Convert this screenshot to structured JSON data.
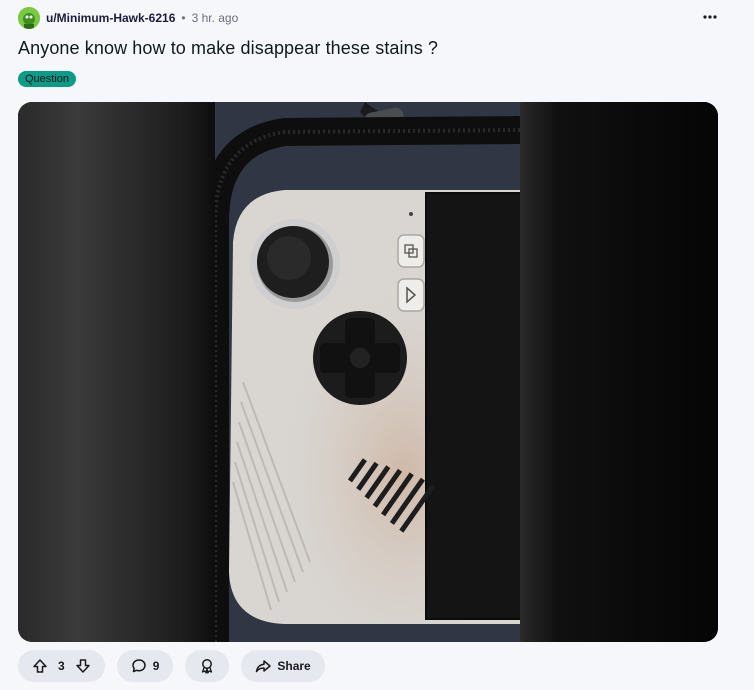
{
  "post": {
    "username": "u/Minimum-Hawk-6216",
    "separator": "•",
    "time": "3 hr. ago",
    "title": "Anyone know how to make disappear these stains ?",
    "flair": "Question",
    "flair_color": "#0a9c87"
  },
  "actions": {
    "vote_count": "3",
    "comment_count": "9",
    "share_label": "Share"
  },
  "icons": {
    "more": "more-horizontal-icon",
    "upvote": "upvote-arrow-icon",
    "downvote": "downvote-arrow-icon",
    "comment": "comment-bubble-icon",
    "award": "award-ribbon-icon",
    "share": "share-arrow-icon"
  }
}
